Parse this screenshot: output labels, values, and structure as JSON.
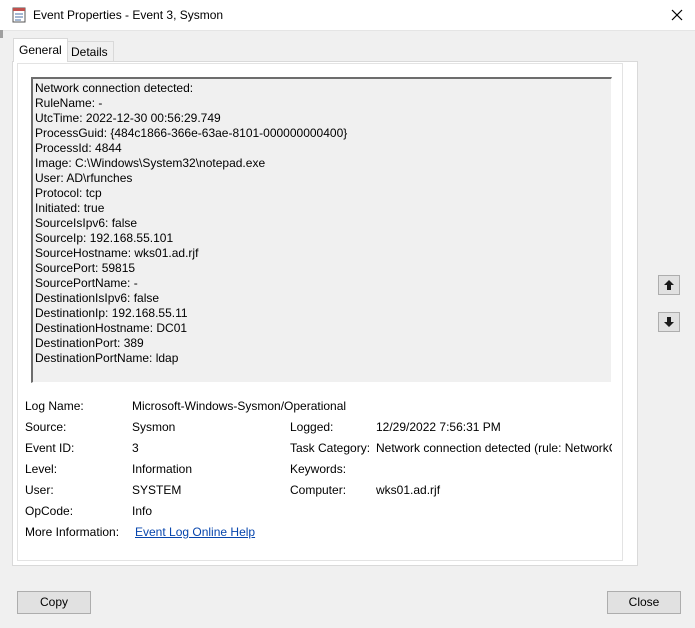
{
  "window": {
    "title": "Event Properties - Event 3, Sysmon",
    "app_icon": "event-viewer-icon",
    "close_icon": "close-icon"
  },
  "tabs": [
    {
      "label": "General",
      "active": true
    },
    {
      "label": "Details",
      "active": false
    }
  ],
  "description_lines": [
    "Network connection detected:",
    "RuleName: -",
    "UtcTime: 2022-12-30 00:56:29.749",
    "ProcessGuid: {484c1866-366e-63ae-8101-000000000400}",
    "ProcessId: 4844",
    "Image: C:\\Windows\\System32\\notepad.exe",
    "User: AD\\rfunches",
    "Protocol: tcp",
    "Initiated: true",
    "SourceIsIpv6: false",
    "SourceIp: 192.168.55.101",
    "SourceHostname: wks01.ad.rjf",
    "SourcePort: 59815",
    "SourcePortName: -",
    "DestinationIsIpv6: false",
    "DestinationIp: 192.168.55.11",
    "DestinationHostname: DC01",
    "DestinationPort: 389",
    "DestinationPortName: ldap"
  ],
  "fields": {
    "log_name": {
      "label": "Log Name:",
      "value": "Microsoft-Windows-Sysmon/Operational"
    },
    "source": {
      "label": "Source:",
      "value": "Sysmon"
    },
    "logged": {
      "label": "Logged:",
      "value": "12/29/2022 7:56:31 PM"
    },
    "event_id": {
      "label": "Event ID:",
      "value": "3"
    },
    "task_category": {
      "label": "Task Category:",
      "value": "Network connection detected (rule: NetworkConnect)"
    },
    "level": {
      "label": "Level:",
      "value": "Information"
    },
    "keywords": {
      "label": "Keywords:",
      "value": ""
    },
    "user": {
      "label": "User:",
      "value": "SYSTEM"
    },
    "computer": {
      "label": "Computer:",
      "value": "wks01.ad.rjf"
    },
    "opcode": {
      "label": "OpCode:",
      "value": "Info"
    },
    "more_info": {
      "label": "More Information:",
      "link": "Event Log Online Help"
    }
  },
  "nav": {
    "up_icon": "arrow-up-icon",
    "down_icon": "arrow-down-icon"
  },
  "buttons": {
    "copy": "Copy",
    "close": "Close"
  }
}
